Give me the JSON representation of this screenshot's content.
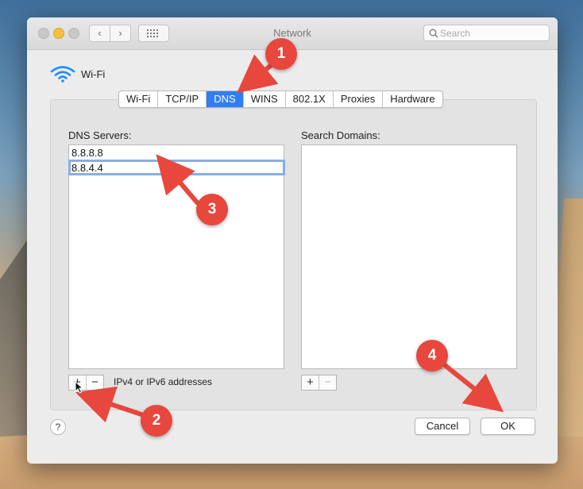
{
  "window": {
    "title": "Network",
    "search_placeholder": "Search"
  },
  "service": {
    "name": "Wi-Fi",
    "icon": "wifi-icon"
  },
  "tabs": [
    {
      "label": "Wi-Fi",
      "active": false
    },
    {
      "label": "TCP/IP",
      "active": false
    },
    {
      "label": "DNS",
      "active": true
    },
    {
      "label": "WINS",
      "active": false
    },
    {
      "label": "802.1X",
      "active": false
    },
    {
      "label": "Proxies",
      "active": false
    },
    {
      "label": "Hardware",
      "active": false
    }
  ],
  "dns": {
    "label": "DNS Servers:",
    "servers": [
      "8.8.8.8",
      "8.8.4.4"
    ],
    "add_symbol": "+",
    "remove_symbol": "−",
    "hint": "IPv4 or IPv6 addresses"
  },
  "domains": {
    "label": "Search Domains:",
    "add_symbol": "+",
    "remove_symbol": "−"
  },
  "footer": {
    "help_symbol": "?",
    "cancel_label": "Cancel",
    "ok_label": "OK"
  },
  "annotations": {
    "badge_color": "#e8473d",
    "step1": "1",
    "step2": "2",
    "step3": "3",
    "step4": "4"
  },
  "colors": {
    "accent": "#2f7ef6",
    "edit_ring": "#86aee4"
  }
}
